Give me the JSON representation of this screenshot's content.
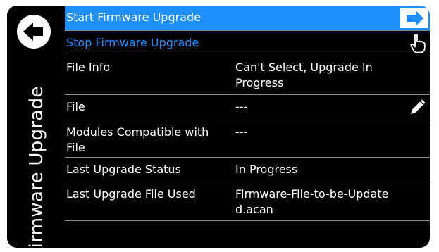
{
  "page": {
    "title": "Firmware Upgrade"
  },
  "actions": [
    {
      "label": "Start Firmware Upgrade",
      "state": "active"
    },
    {
      "label": "Stop Firmware Upgrade",
      "state": "disabled"
    }
  ],
  "rows": [
    {
      "label": "File Info",
      "value": "Can't Select, Upgrade In Progress"
    },
    {
      "label": "File",
      "value": "---"
    },
    {
      "label": "Modules Compatible with File",
      "value": "---"
    },
    {
      "label": "Last Upgrade Status",
      "value": "In Progress"
    },
    {
      "label": "Last Upgrade File Used",
      "value": "Firmware-File-to-be-Updated.acan"
    }
  ],
  "colors": {
    "accent": "#1e90ff",
    "background": "#000000",
    "text": "#ffffff",
    "divider": "#8a8a8a"
  },
  "icons": {
    "back": "back-arrow-icon",
    "start": "right-arrow-icon",
    "stop": "pointing-hand-icon",
    "edit": "pencil-icon"
  }
}
